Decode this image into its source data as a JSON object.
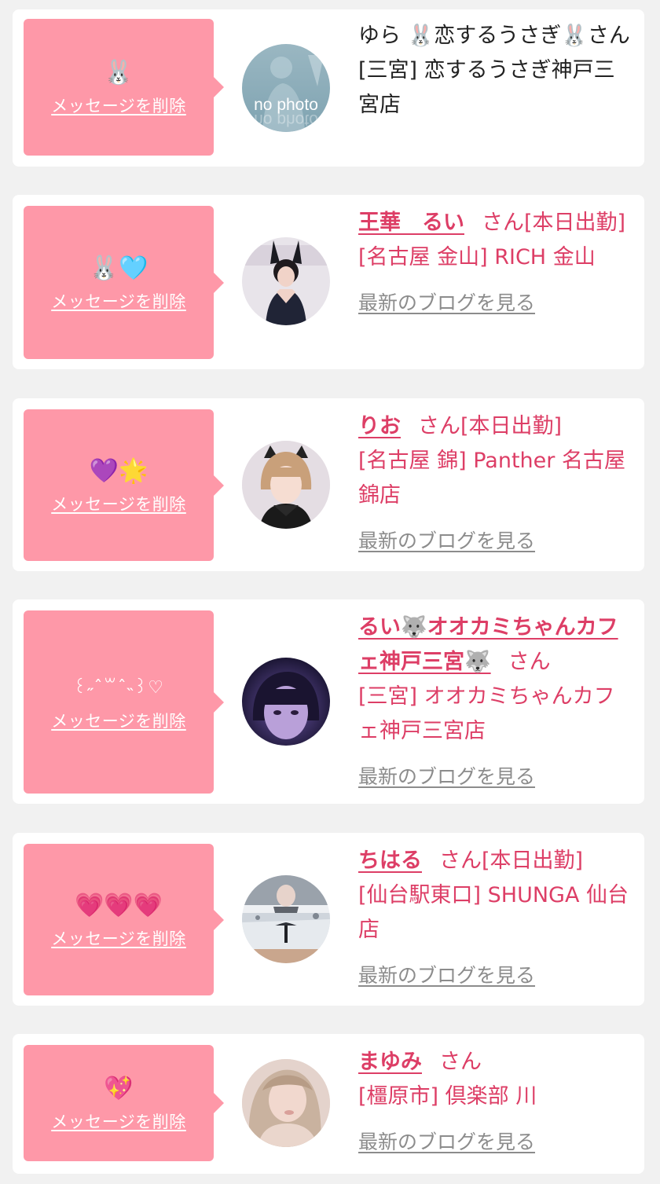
{
  "delete_label": "メッセージを削除",
  "blog_label": "最新のブログを見る",
  "san_suffix": "さん",
  "colors": {
    "page_bg": "#f1f1f1",
    "card_bg": "#ffffff",
    "bubble_bg": "#fe98a8",
    "accent": "#dd3e66",
    "muted_link": "#8c8c8c"
  },
  "entries": [
    {
      "message": "🐰",
      "name_line": "ゆら 🐰恋するうさぎ🐰さん",
      "shop": "[三宮] 恋するうさぎ神戸三宮店",
      "avatar_label": "no photo"
    },
    {
      "message": "🐰🩵",
      "name": "王華　るい",
      "status": "[本日出勤]",
      "shop": "[名古屋 金山] RICH 金山"
    },
    {
      "message": "💜🌟",
      "name": "りお",
      "status": "[本日出勤]",
      "shop": "[名古屋 錦] Panther 名古屋錦店"
    },
    {
      "message": "꒰˶ˆ꒳ˆ˵꒱♡",
      "name": "るい🐺オオカミちゃんカフェ神戸三宮🐺",
      "status": "",
      "shop": "[三宮] オオカミちゃんカフェ神戸三宮店"
    },
    {
      "message": "💗💗💗",
      "name": "ちはる",
      "status": "[本日出勤]",
      "shop": "[仙台駅東口] SHUNGA 仙台店"
    },
    {
      "message": "💖",
      "name": "まゆみ",
      "status": "",
      "shop": "[橿原市] 倶楽部 川"
    }
  ]
}
